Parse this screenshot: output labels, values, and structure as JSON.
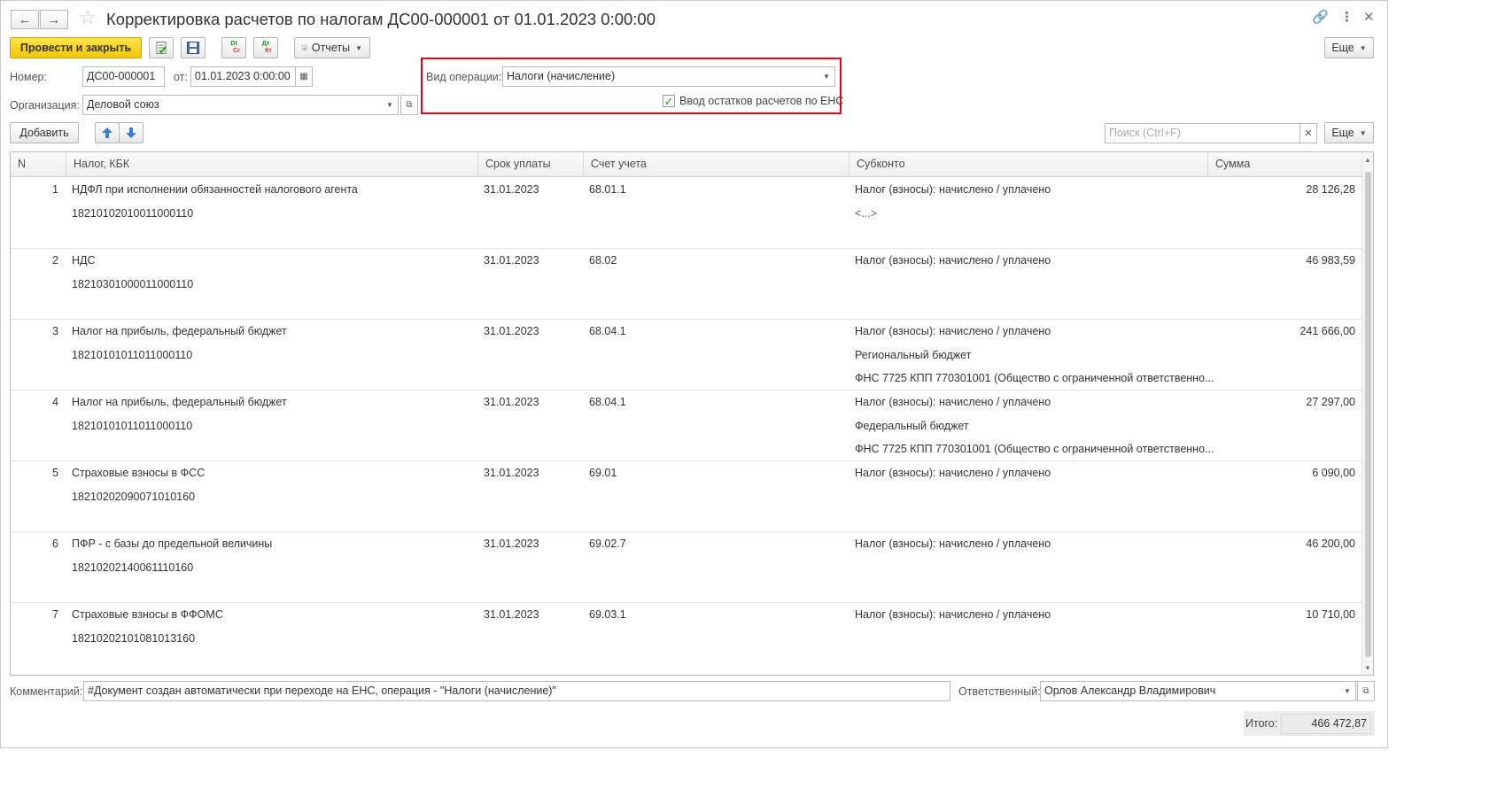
{
  "window": {
    "title": "Корректировка расчетов по налогам ДС00-000001 от 01.01.2023 0:00:00"
  },
  "toolbar": {
    "post_close": "Провести и закрыть",
    "reports": "Отчеты",
    "more": "Еще",
    "dt_label": "Dt",
    "cr_label": "Cr",
    "dt_ru_label": "Дт",
    "kt_ru_label": "Кт"
  },
  "form": {
    "number_label": "Номер:",
    "number_value": "ДС00-000001",
    "date_label": "от:",
    "date_value": "01.01.2023  0:00:00",
    "org_label": "Организация:",
    "org_value": "Деловой союз",
    "operation_label": "Вид операции:",
    "operation_value": "Налоги (начисление)",
    "ens_checkbox_label": "Ввод остатков расчетов по ЕНС",
    "ens_checked": true
  },
  "table_toolbar": {
    "add": "Добавить",
    "search_placeholder": "Поиск (Ctrl+F)",
    "more": "Еще"
  },
  "table": {
    "columns": [
      "N",
      "Налог, КБК",
      "Срок уплаты",
      "Счет учета",
      "Субконто",
      "Сумма"
    ],
    "rows": [
      {
        "n": "1",
        "tax": "НДФЛ при исполнении обязанностей налогового агента",
        "kbk": "18210102010011000110",
        "due": "31.01.2023",
        "account": "68.01.1",
        "sub1": "Налог (взносы): начислено / уплачено",
        "sub2": "<...>",
        "sub3": "",
        "sum": "28 126,28"
      },
      {
        "n": "2",
        "tax": "НДС",
        "kbk": "18210301000011000110",
        "due": "31.01.2023",
        "account": "68.02",
        "sub1": "Налог (взносы): начислено / уплачено",
        "sub2": "",
        "sub3": "",
        "sum": "46 983,59"
      },
      {
        "n": "3",
        "tax": "Налог на прибыль, федеральный бюджет",
        "kbk": "18210101011011000110",
        "due": "31.01.2023",
        "account": "68.04.1",
        "sub1": "Налог (взносы): начислено / уплачено",
        "sub2": "Региональный бюджет",
        "sub3": "ФНС 7725 КПП 770301001 (Общество с ограниченной ответственно...",
        "sum": "241 666,00"
      },
      {
        "n": "4",
        "tax": "Налог на прибыль, федеральный бюджет",
        "kbk": "18210101011011000110",
        "due": "31.01.2023",
        "account": "68.04.1",
        "sub1": "Налог (взносы): начислено / уплачено",
        "sub2": "Федеральный бюджет",
        "sub3": "ФНС 7725 КПП 770301001 (Общество с ограниченной ответственно...",
        "sum": "27 297,00"
      },
      {
        "n": "5",
        "tax": "Страховые взносы в ФСС",
        "kbk": "18210202090071010160",
        "due": "31.01.2023",
        "account": "69.01",
        "sub1": "Налог (взносы): начислено / уплачено",
        "sub2": "",
        "sub3": "",
        "sum": "6 090,00"
      },
      {
        "n": "6",
        "tax": "ПФР - с базы до предельной величины",
        "kbk": "18210202140061110160",
        "due": "31.01.2023",
        "account": "69.02.7",
        "sub1": "Налог (взносы): начислено / уплачено",
        "sub2": "",
        "sub3": "",
        "sum": "46 200,00"
      },
      {
        "n": "7",
        "tax": "Страховые взносы в ФФОМС",
        "kbk": "18210202101081013160",
        "due": "31.01.2023",
        "account": "69.03.1",
        "sub1": "Налог (взносы): начислено / уплачено",
        "sub2": "",
        "sub3": "",
        "sum": "10 710,00"
      }
    ]
  },
  "footer": {
    "comment_label": "Комментарий:",
    "comment_value": "#Документ создан автоматически при переходе на ЕНС, операция - \"Налоги (начисление)\"",
    "responsible_label": "Ответственный:",
    "responsible_value": "Орлов Александр Владимирович",
    "total_label": "Итого:",
    "total_value": "466 472,87"
  },
  "colors": {
    "primary_button": "#f6c700",
    "highlight_border": "#e0001a",
    "checkbox_mark": "#2a9a2a"
  }
}
